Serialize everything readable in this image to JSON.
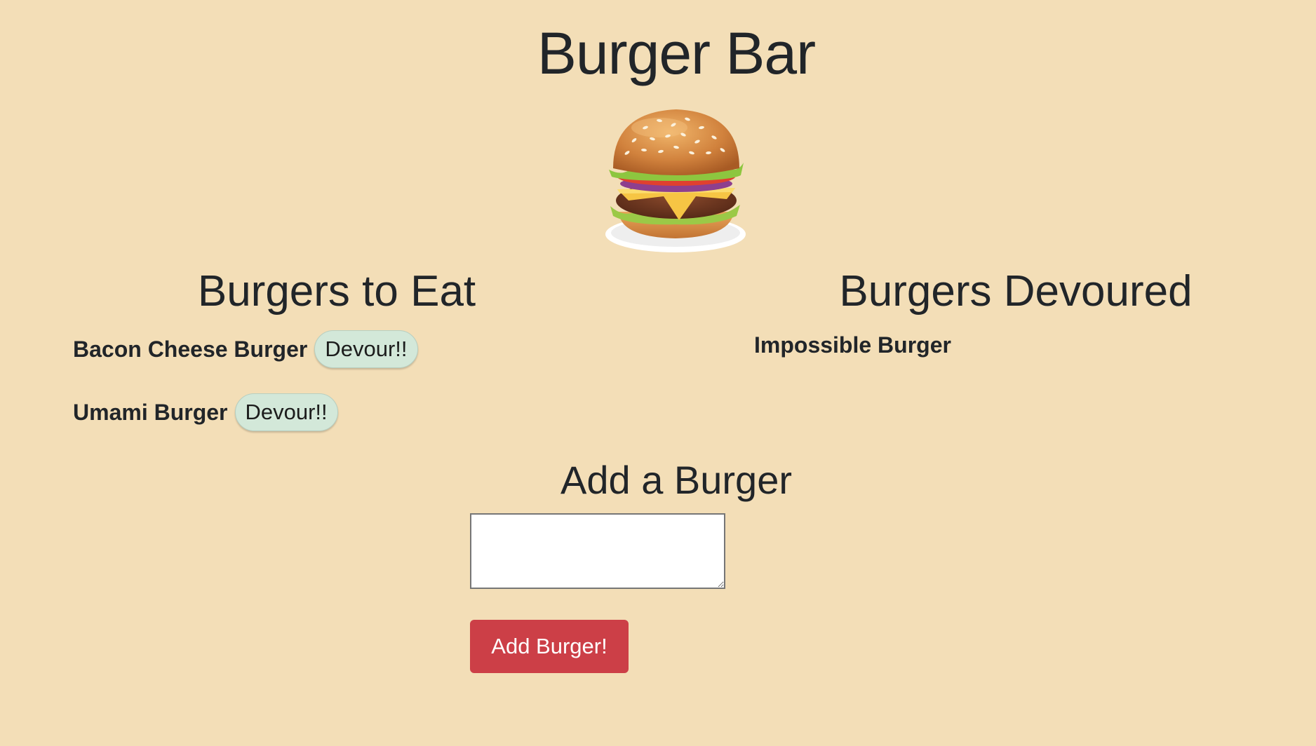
{
  "header": {
    "title": "Burger Bar",
    "logo_icon": "burger-icon"
  },
  "to_eat": {
    "heading": "Burgers to Eat",
    "items": [
      {
        "name": "Bacon Cheese Burger",
        "action_label": "Devour!!"
      },
      {
        "name": "Umami Burger",
        "action_label": "Devour!!"
      }
    ]
  },
  "devoured": {
    "heading": "Burgers Devoured",
    "items": [
      {
        "name": "Impossible Burger"
      }
    ]
  },
  "add_form": {
    "heading": "Add a Burger",
    "input_value": "",
    "submit_label": "Add Burger!"
  },
  "colors": {
    "background": "#f3deb7",
    "devour_button": "#d3e8d9",
    "add_button": "#cc3f47"
  }
}
